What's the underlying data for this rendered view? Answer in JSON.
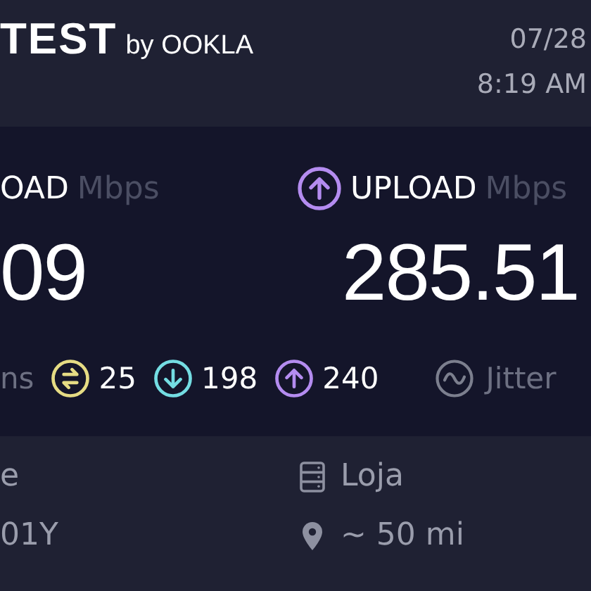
{
  "header": {
    "logo": "TEST",
    "logo_suffix": "by OOKLA",
    "date": "07/28",
    "time": "8:19 AM"
  },
  "results": [
    {
      "kind": "download",
      "label": "OAD",
      "unit": "Mbps",
      "value": "09"
    },
    {
      "kind": "upload",
      "label": "UPLOAD",
      "unit": "Mbps",
      "value": "285.51"
    }
  ],
  "ping": {
    "unit": "ns",
    "items": [
      {
        "kind": "idle",
        "value": "25"
      },
      {
        "kind": "download",
        "value": "198"
      },
      {
        "kind": "upload",
        "value": "240"
      }
    ],
    "jitter_label": "Jitter"
  },
  "provider": {
    "name": "e",
    "host": "01Y"
  },
  "server": {
    "name": "Loja",
    "distance": "~ 50 mi"
  }
}
